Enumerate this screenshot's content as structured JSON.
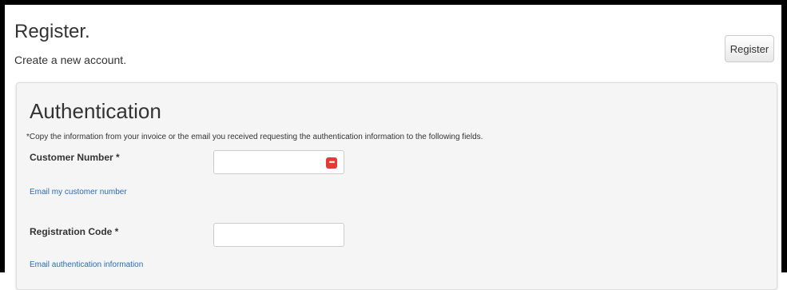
{
  "header": {
    "title": "Register.",
    "subtitle": "Create a new account.",
    "register_button_label": "Register"
  },
  "authentication": {
    "title": "Authentication",
    "instructions": "*Copy the information from your invoice or the email you received requesting the authentication information to the following fields.",
    "fields": [
      {
        "label": "Customer Number *",
        "value": "",
        "link_text": "Email my customer number"
      },
      {
        "label": "Registration Code *",
        "value": "",
        "link_text": "Email authentication information"
      }
    ]
  },
  "icons": {
    "password_manager": "password-manager-icon"
  },
  "colors": {
    "link": "#2a6db5",
    "panel_background": "#f5f5f5",
    "password_manager_icon": "#e53935"
  }
}
